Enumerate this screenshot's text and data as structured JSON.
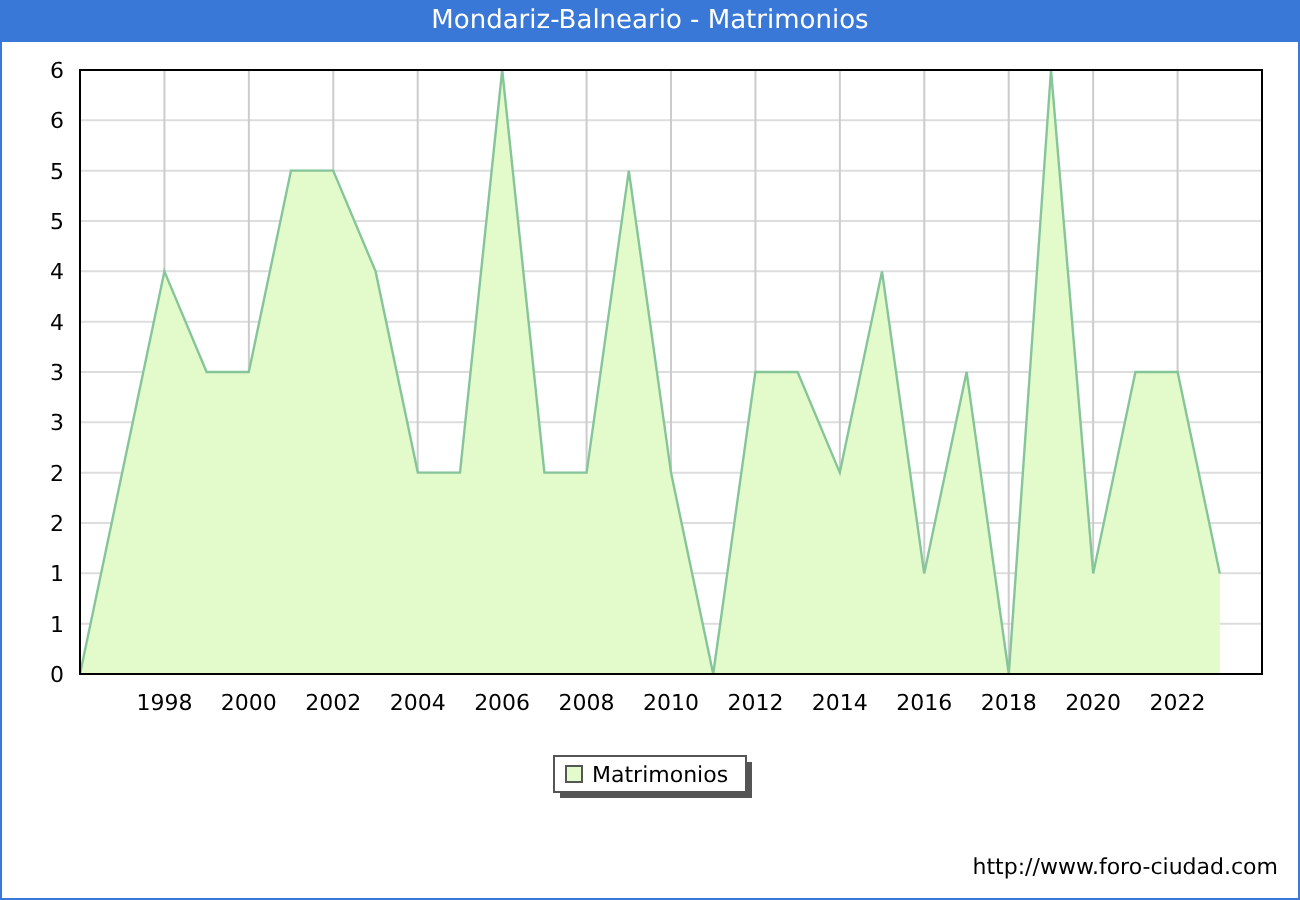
{
  "window": {
    "title": "Mondariz-Balneario - Matrimonios"
  },
  "chart": {
    "chart_data": {
      "type": "area",
      "x": [
        1996,
        1997,
        1998,
        1999,
        2000,
        2001,
        2002,
        2003,
        2004,
        2005,
        2006,
        2007,
        2008,
        2009,
        2010,
        2011,
        2012,
        2013,
        2014,
        2015,
        2016,
        2017,
        2018,
        2019,
        2020,
        2021,
        2022,
        2023
      ],
      "series": [
        {
          "name": "Matrimonios",
          "color": "#e3fbcb",
          "values": [
            0,
            2,
            4,
            3,
            3,
            5,
            5,
            4,
            2,
            2,
            6,
            2,
            2,
            5,
            2,
            0,
            3,
            3,
            2,
            4,
            1,
            3,
            0,
            6,
            1,
            3,
            3,
            1
          ]
        }
      ],
      "xlim": [
        1996,
        2024
      ],
      "ylim": [
        0,
        6
      ],
      "grid": true,
      "xticks": [
        1998,
        2000,
        2002,
        2004,
        2006,
        2008,
        2010,
        2012,
        2014,
        2016,
        2018,
        2020,
        2022
      ],
      "yticks": [
        0,
        {
          "value": 0.5,
          "label": "1"
        },
        1,
        {
          "value": 1.5,
          "label": "2"
        },
        2,
        {
          "value": 2.5,
          "label": "3"
        },
        3,
        {
          "value": 3.5,
          "label": "4"
        },
        4,
        {
          "value": 4.5,
          "label": "5"
        },
        5,
        {
          "value": 5.5,
          "label": "6"
        },
        6
      ]
    }
  },
  "footer": "http://www.foro-ciudad.com"
}
